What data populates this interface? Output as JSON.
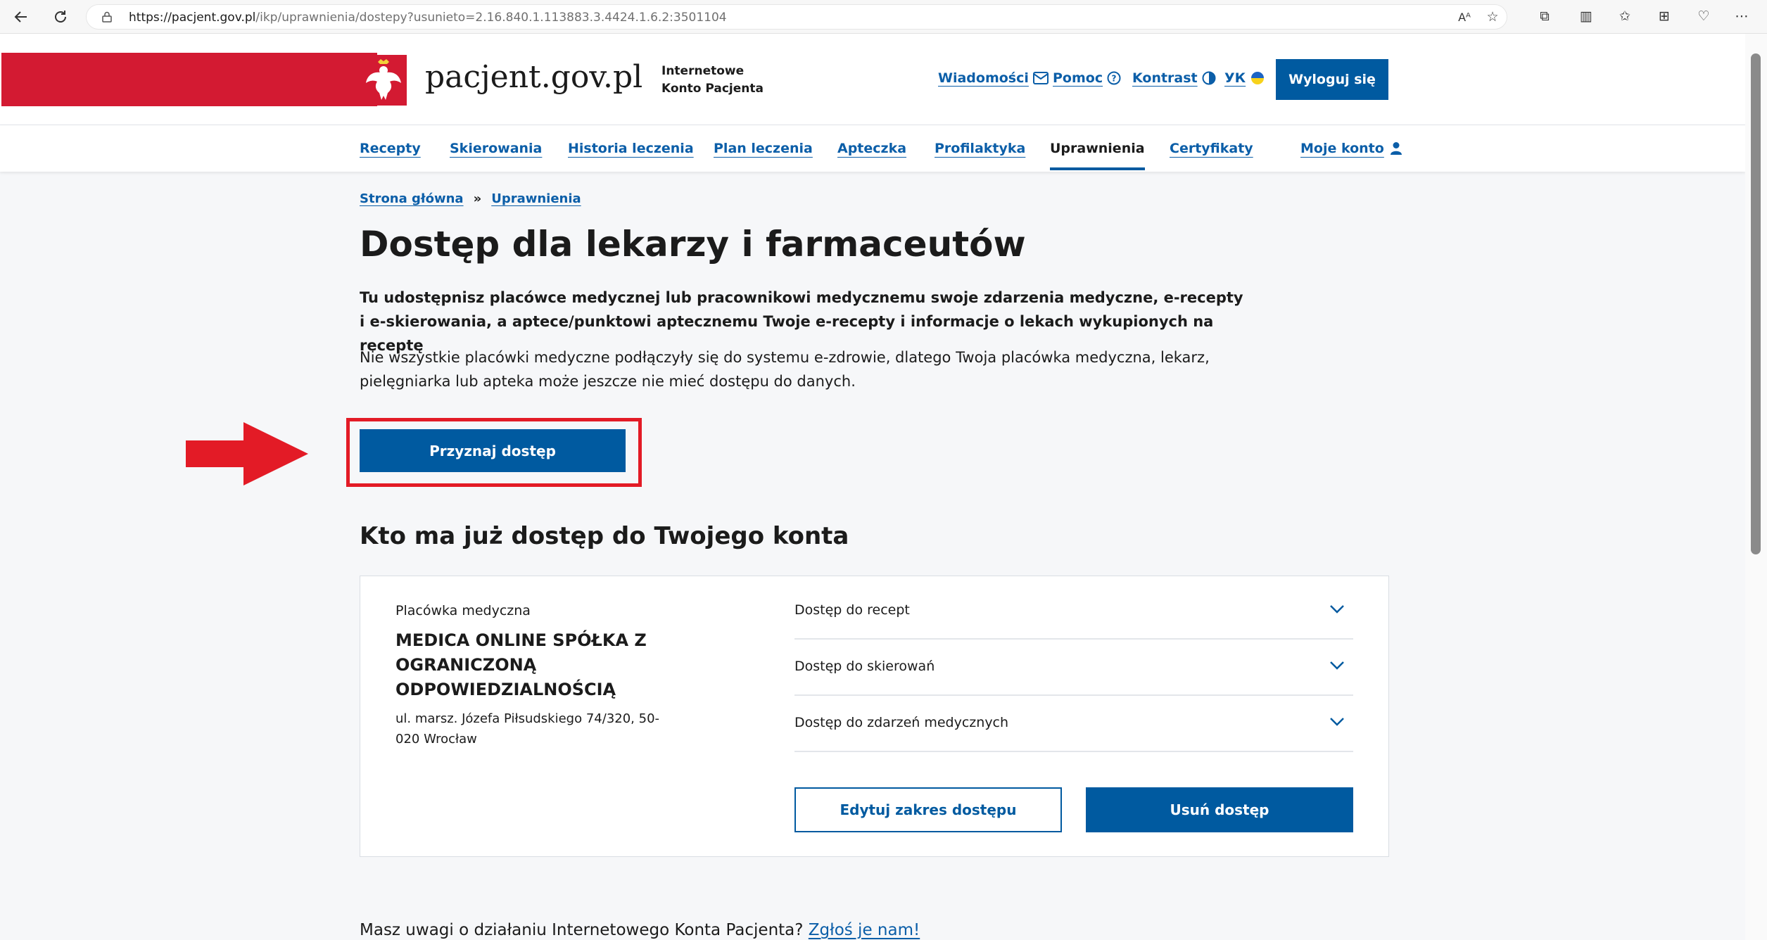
{
  "browser": {
    "url_host": "https://pacjent.gov.pl",
    "url_path": "/ikp/uprawnienia/dostepy?usunieto=2.16.840.1.113883.3.4424.1.6.2:3501104",
    "read_aloud_label": "Aᴬ"
  },
  "header": {
    "site_name": "pacjent.gov.pl",
    "subtitle_line1": "Internetowe",
    "subtitle_line2": "Konto Pacjenta",
    "links": {
      "messages": "Wiadomości",
      "help": "Pomoc",
      "contrast": "Kontrast",
      "language": "УК"
    },
    "logout": "Wyloguj się"
  },
  "nav": {
    "items": [
      {
        "label": "Recepty"
      },
      {
        "label": "Skierowania"
      },
      {
        "label": "Historia leczenia"
      },
      {
        "label": "Plan leczenia"
      },
      {
        "label": "Apteczka"
      },
      {
        "label": "Profilaktyka"
      },
      {
        "label": "Uprawnienia"
      },
      {
        "label": "Certyfikaty"
      }
    ],
    "account": "Moje konto"
  },
  "breadcrumb": {
    "home": "Strona główna",
    "separator": "»",
    "current": "Uprawnienia"
  },
  "main": {
    "title": "Dostęp dla lekarzy i farmaceutów",
    "lead_line1": "Tu udostępnisz placówce medycznej lub pracownikowi medycznemu swoje zdarzenia medyczne, e-recepty",
    "lead_line2": "i e-skierowania, a aptece/punktowi aptecznemu Twoje e-recepty i informacje o lekach wykupionych na receptę",
    "info_line1": "Nie wszystkie placówki medyczne podłączyły się do systemu e-zdrowie, dlatego Twoja placówka medyczna, lekarz,",
    "info_line2": "pielęgniarka lub apteka może jeszcze nie mieć dostępu do danych.",
    "grant_button": "Przyznaj dostęp",
    "section_title": "Kto ma już dostęp do Twojego konta"
  },
  "access_card": {
    "type": "Placówka medyczna",
    "name_line1": "MEDICA ONLINE SPÓŁKA Z",
    "name_line2": "OGRANICZONĄ",
    "name_line3": "ODPOWIEDZIALNOŚCIĄ",
    "address_line1": "ul. marsz. Józefa Piłsudskiego 74/320, 50-",
    "address_line2": "020 Wrocław",
    "accordions": [
      {
        "label": "Dostęp do recept"
      },
      {
        "label": "Dostęp do skierowań"
      },
      {
        "label": "Dostęp do zdarzeń medycznych"
      }
    ],
    "edit_button": "Edytuj zakres dostępu",
    "remove_button": "Usuń dostęp"
  },
  "footer": {
    "feedback_text": "Masz uwagi o działaniu Internetowego Konta Pacjenta?",
    "feedback_link": "Zgłoś je nam!"
  },
  "colors": {
    "brand_blue": "#005aa0",
    "link_blue": "#0b5ea8",
    "flag_red": "#d31a32",
    "annotation_red": "#e31b26"
  }
}
